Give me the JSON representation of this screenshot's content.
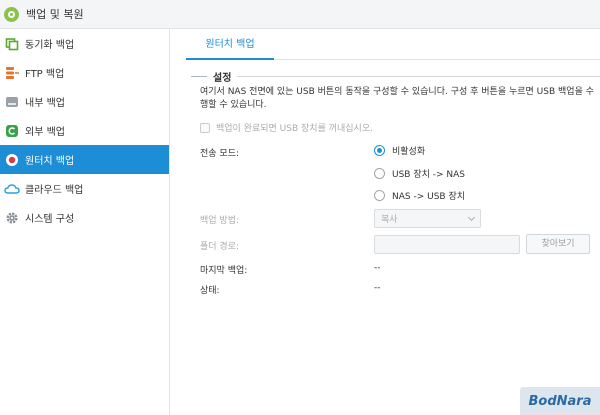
{
  "window": {
    "title": "백업 및 복원"
  },
  "sidebar": {
    "items": [
      {
        "label": "동기화 백업",
        "icon": "sync-icon",
        "active": false
      },
      {
        "label": "FTP 백업",
        "icon": "ftp-icon",
        "active": false
      },
      {
        "label": "내부 백업",
        "icon": "internal-drive-icon",
        "active": false
      },
      {
        "label": "외부 백업",
        "icon": "external-backup-icon",
        "active": false
      },
      {
        "label": "원터치 백업",
        "icon": "one-touch-icon",
        "active": true
      },
      {
        "label": "클라우드 백업",
        "icon": "cloud-icon",
        "active": false
      },
      {
        "label": "시스템 구성",
        "icon": "gear-icon",
        "active": false
      }
    ]
  },
  "main": {
    "tab_label": "원터치 백업",
    "section_title": "설정",
    "description": "여기서 NAS 전면에 있는 USB 버튼의 동작을 구성할 수 있습니다. 구성 후 버튼을 누르면 USB 백업을 수행할 수 있습니다.",
    "eject_checkbox_label": "백업이 완료되면 USB 장치를 꺼내십시오.",
    "transfer_mode_label": "전송 모드:",
    "transfer_modes": [
      "비활성화",
      "USB 장치 -> NAS",
      "NAS -> USB 장치"
    ],
    "selected_mode": 0,
    "backup_method_label": "백업 방법:",
    "backup_method_value": "복사",
    "folder_path_label": "폴더 경로:",
    "folder_path_value": "",
    "browse_label": "찾아보기",
    "last_backup_label": "마지막 백업:",
    "last_backup_value": "--",
    "status_label": "상태:",
    "status_value": "--"
  },
  "watermark": "BodNara",
  "colors": {
    "accent": "#1d8ed6",
    "app_icon": "#8bc34a"
  }
}
